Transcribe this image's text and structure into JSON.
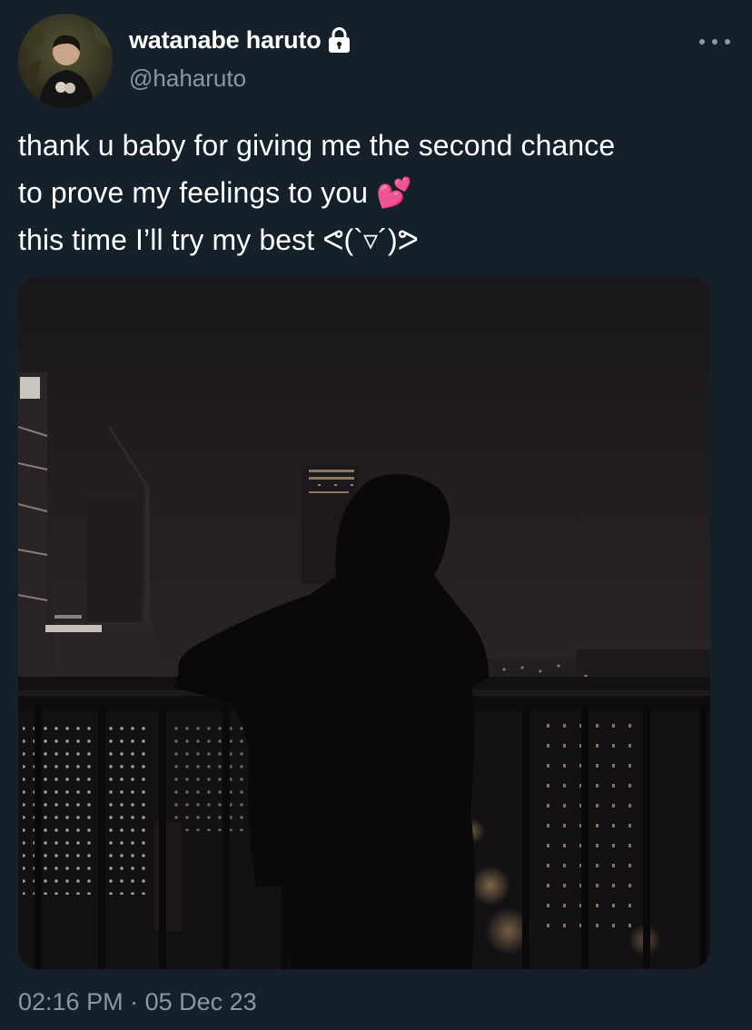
{
  "author": {
    "display_name": "watanabe haruto",
    "handle": "@haharuto",
    "protected_icon": "lock-icon",
    "avatar_icon": "profile-avatar"
  },
  "menu": {
    "more_icon": "more-horizontal-icon"
  },
  "tweet": {
    "lines": [
      "thank u baby for giving me the second chance",
      "to prove my feelings to you 💕",
      "this time I’ll try my best ᕙ(`▿´)ᕗ"
    ]
  },
  "media": {
    "type": "photo",
    "icon": "night-city-balcony-photo"
  },
  "meta": {
    "time": "02:16 PM",
    "separator": " · ",
    "date": "05 Dec 23"
  },
  "colors": {
    "background": "#15202b",
    "text_primary": "#ffffff",
    "text_secondary": "#8899a6"
  }
}
